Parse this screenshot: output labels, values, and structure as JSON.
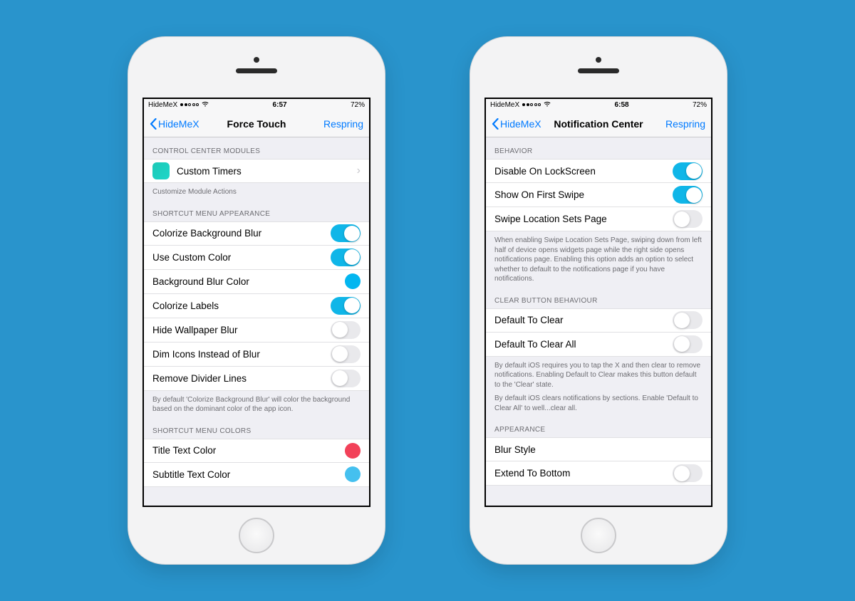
{
  "colors": {
    "accent": "#007aff",
    "switch_on": "#10b6e8",
    "blur_color": "#03b6f0",
    "title_text": "#f24159",
    "subtitle_text": "#45c0ef"
  },
  "left": {
    "status": {
      "carrier": "HideMeX",
      "time": "6:57",
      "battery": "72%"
    },
    "nav": {
      "back": "HideMeX",
      "title": "Force Touch",
      "action": "Respring"
    },
    "sections": {
      "modules": {
        "header": "CONTROL CENTER MODULES",
        "item": "Custom Timers",
        "footer": "Customize Module Actions"
      },
      "appearance": {
        "header": "SHORTCUT MENU APPEARANCE",
        "items": {
          "colorize_bg": "Colorize Background Blur",
          "use_custom": "Use Custom Color",
          "bg_color": "Background Blur Color",
          "colorize_labels": "Colorize Labels",
          "hide_wallpaper": "Hide Wallpaper Blur",
          "dim_icons": "Dim Icons Instead of Blur",
          "remove_divider": "Remove Divider Lines"
        },
        "footer": "By default 'Colorize Background Blur' will color the background based on the dominant color of the app icon."
      },
      "colors": {
        "header": "SHORTCUT MENU COLORS",
        "title_text": "Title Text Color",
        "subtitle_text": "Subtitle Text Color"
      }
    }
  },
  "right": {
    "status": {
      "carrier": "HideMeX",
      "time": "6:58",
      "battery": "72%"
    },
    "nav": {
      "back": "HideMeX",
      "title": "Notification Center",
      "action": "Respring"
    },
    "sections": {
      "behavior": {
        "header": "BEHAVIOR",
        "disable_ls": "Disable On LockScreen",
        "first_swipe": "Show On First Swipe",
        "swipe_loc": "Swipe Location Sets Page",
        "footer": "When enabling Swipe Location Sets Page, swiping down from left half of device opens widgets page while the right side opens notifications page. Enabling this option adds an option to select whether to default to the notifications page if you have notifications."
      },
      "clear": {
        "header": "CLEAR BUTTON BEHAVIOUR",
        "default_clear": "Default To Clear",
        "default_clear_all": "Default To Clear All",
        "footer1": "By default iOS requires you to tap the X and then clear to remove notifications. Enabling Default to Clear makes this button default to the 'Clear' state.",
        "footer2": "By default iOS clears notifications by sections. Enable 'Default to Clear All' to well...clear all."
      },
      "appearance": {
        "header": "APPEARANCE",
        "blur_style": "Blur Style",
        "extend": "Extend To Bottom"
      }
    }
  }
}
